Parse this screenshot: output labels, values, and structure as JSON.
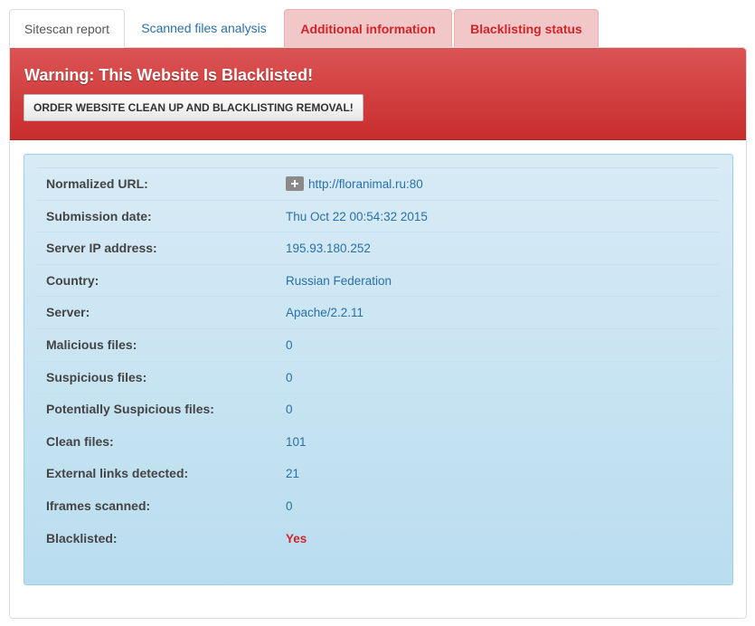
{
  "tabs": [
    {
      "label": "Sitescan report"
    },
    {
      "label": "Scanned files analysis"
    },
    {
      "label": "Additional information"
    },
    {
      "label": "Blacklisting status"
    }
  ],
  "banner": {
    "title": "Warning: This Website Is Blacklisted!",
    "order_button": "ORDER WEBSITE CLEAN UP AND BLACKLISTING REMOVAL!"
  },
  "report": {
    "rows": [
      {
        "label": "Normalized URL:",
        "value": "http://floranimal.ru:80"
      },
      {
        "label": "Submission date:",
        "value": "Thu Oct 22 00:54:32 2015"
      },
      {
        "label": "Server IP address:",
        "value": "195.93.180.252"
      },
      {
        "label": "Country:",
        "value": "Russian Federation"
      },
      {
        "label": "Server:",
        "value": "Apache/2.2.11"
      },
      {
        "label": "Malicious files:",
        "value": "0"
      },
      {
        "label": "Suspicious files:",
        "value": "0"
      },
      {
        "label": "Potentially Suspicious files:",
        "value": "0"
      },
      {
        "label": "Clean files:",
        "value": "101"
      },
      {
        "label": "External links detected:",
        "value": "21"
      },
      {
        "label": "Iframes scanned:",
        "value": "0"
      },
      {
        "label": "Blacklisted:",
        "value": "Yes"
      }
    ]
  },
  "colors": {
    "banner_red": "#c92d2d",
    "link_blue": "#2a6fa8",
    "alert_red": "#d2232a",
    "info_bg": "#b9ddef"
  },
  "icons": {
    "url_expand": "plus-icon"
  }
}
